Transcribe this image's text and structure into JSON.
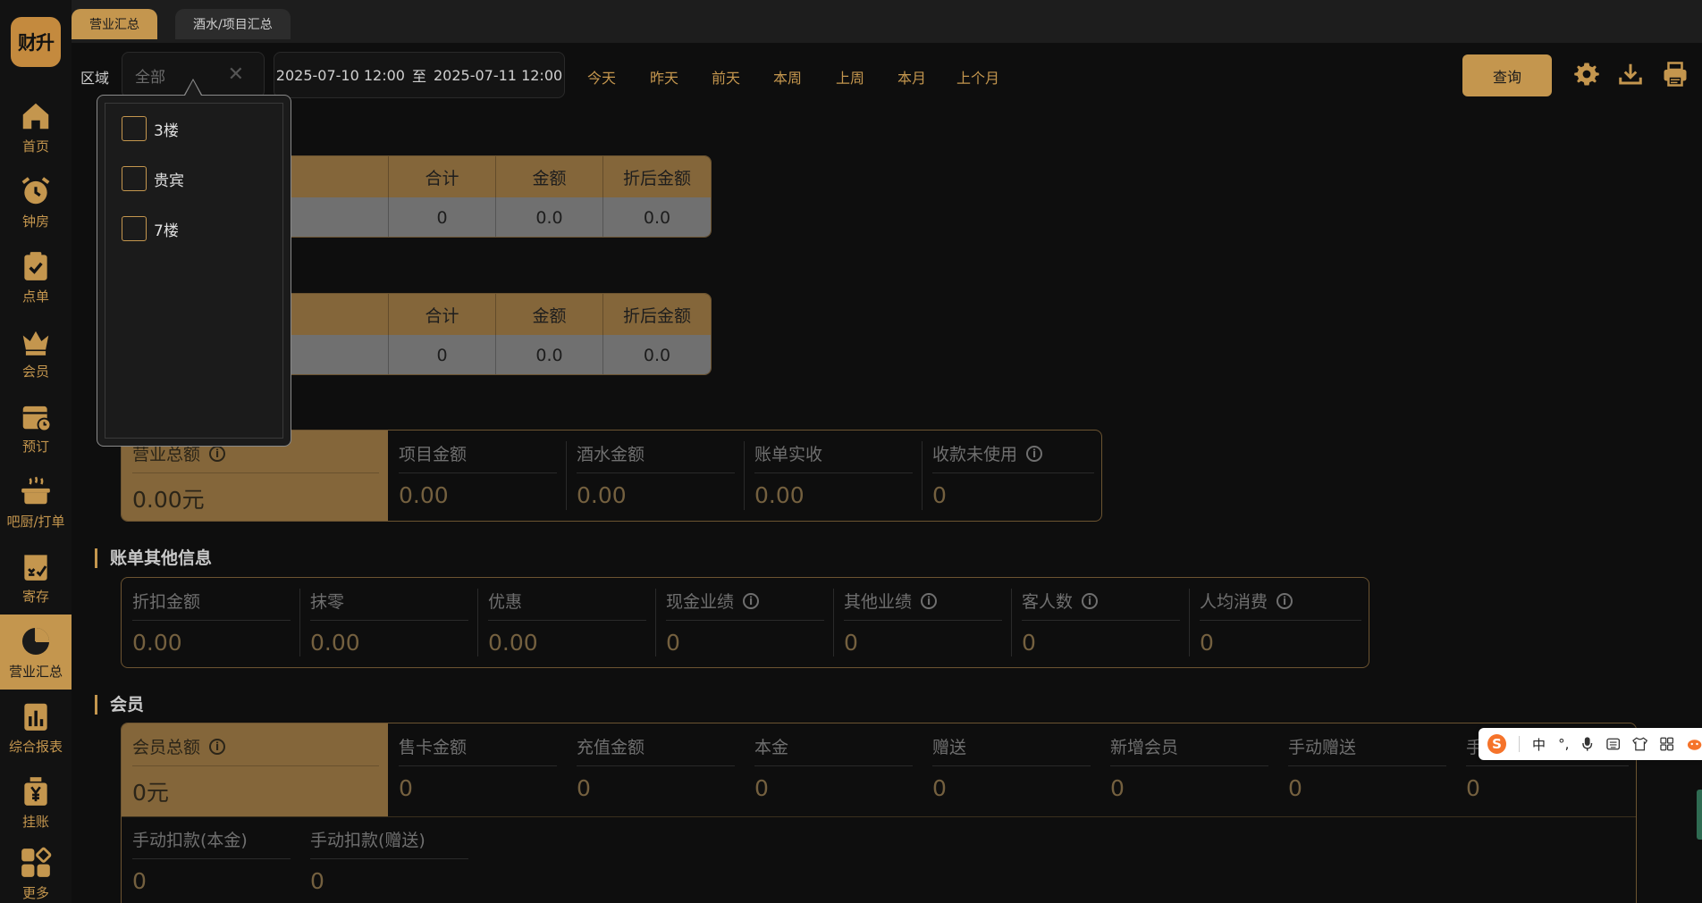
{
  "app": {
    "logo_text": "财升"
  },
  "sidebar": {
    "items": [
      {
        "id": "home",
        "label": "首页",
        "icon": "home-icon"
      },
      {
        "id": "clock",
        "label": "钟房",
        "icon": "alarm-clock-icon"
      },
      {
        "id": "order",
        "label": "点单",
        "icon": "clipboard-check-icon"
      },
      {
        "id": "member",
        "label": "会员",
        "icon": "crown-icon"
      },
      {
        "id": "reserve",
        "label": "预订",
        "icon": "calendar-clock-icon"
      },
      {
        "id": "kitchen",
        "label": "吧厨/打单",
        "icon": "pot-icon"
      },
      {
        "id": "storage",
        "label": "寄存",
        "icon": "storage-box-icon"
      },
      {
        "id": "summary",
        "label": "营业汇总",
        "icon": "pie-chart-icon",
        "active": true
      },
      {
        "id": "report",
        "label": "综合报表",
        "icon": "bar-report-icon"
      },
      {
        "id": "credit",
        "label": "挂账",
        "icon": "yen-bag-icon"
      },
      {
        "id": "more",
        "label": "更多",
        "icon": "grid-more-icon"
      }
    ]
  },
  "tabs": [
    {
      "label": "营业汇总",
      "active": true
    },
    {
      "label": "酒水/项目汇总",
      "active": false
    }
  ],
  "filters": {
    "area_label": "区域",
    "area_placeholder": "全部",
    "date_start": "2025-07-10 12:00",
    "date_sep": "至",
    "date_end": "2025-07-11 12:00",
    "quick_ranges": [
      "今天",
      "昨天",
      "前天",
      "本周",
      "上周",
      "本月",
      "上个月"
    ],
    "query_label": "查询"
  },
  "dropdown": {
    "options": [
      "3楼",
      "贵宾",
      "7楼"
    ]
  },
  "table1": {
    "headers": [
      "合计",
      "金额",
      "折后金额"
    ],
    "values": [
      "0",
      "0.0",
      "0.0"
    ]
  },
  "table2": {
    "headers": [
      "合计",
      "金额",
      "折后金额"
    ],
    "values": [
      "0",
      "0.0",
      "0.0"
    ]
  },
  "revenue": {
    "total_label": "营业总额",
    "total_value": "0.00元",
    "cells": [
      {
        "label": "项目金额",
        "value": "0.00"
      },
      {
        "label": "酒水金额",
        "value": "0.00"
      },
      {
        "label": "账单实收",
        "value": "0.00"
      },
      {
        "label": "收款未使用",
        "value": "0"
      }
    ]
  },
  "bill_other": {
    "title": "账单其他信息",
    "cells": [
      {
        "label": "折扣金额",
        "value": "0.00"
      },
      {
        "label": "抹零",
        "value": "0.00"
      },
      {
        "label": "优惠",
        "value": "0.00"
      },
      {
        "label": "现金业绩",
        "value": "0"
      },
      {
        "label": "其他业绩",
        "value": "0"
      },
      {
        "label": "客人数",
        "value": "0"
      },
      {
        "label": "人均消费",
        "value": "0"
      }
    ]
  },
  "member": {
    "title": "会员",
    "total_label": "会员总额",
    "total_value": "0元",
    "cells": [
      {
        "label": "售卡金额",
        "value": "0"
      },
      {
        "label": "充值金额",
        "value": "0"
      },
      {
        "label": "本金",
        "value": "0"
      },
      {
        "label": "赠送",
        "value": "0"
      },
      {
        "label": "新增会员",
        "value": "0"
      },
      {
        "label": "手动赠送",
        "value": "0"
      },
      {
        "label": "手",
        "value": "0"
      }
    ],
    "row2": [
      {
        "label": "手动扣款(本金)",
        "value": "0"
      },
      {
        "label": "手动扣款(赠送)",
        "value": "0"
      }
    ]
  },
  "ime": {
    "logo": "S",
    "mode": "中",
    "punct": "°,"
  },
  "colors": {
    "accent": "#c4964e",
    "background": "#0e0e0e",
    "sidebar": "#121212"
  }
}
